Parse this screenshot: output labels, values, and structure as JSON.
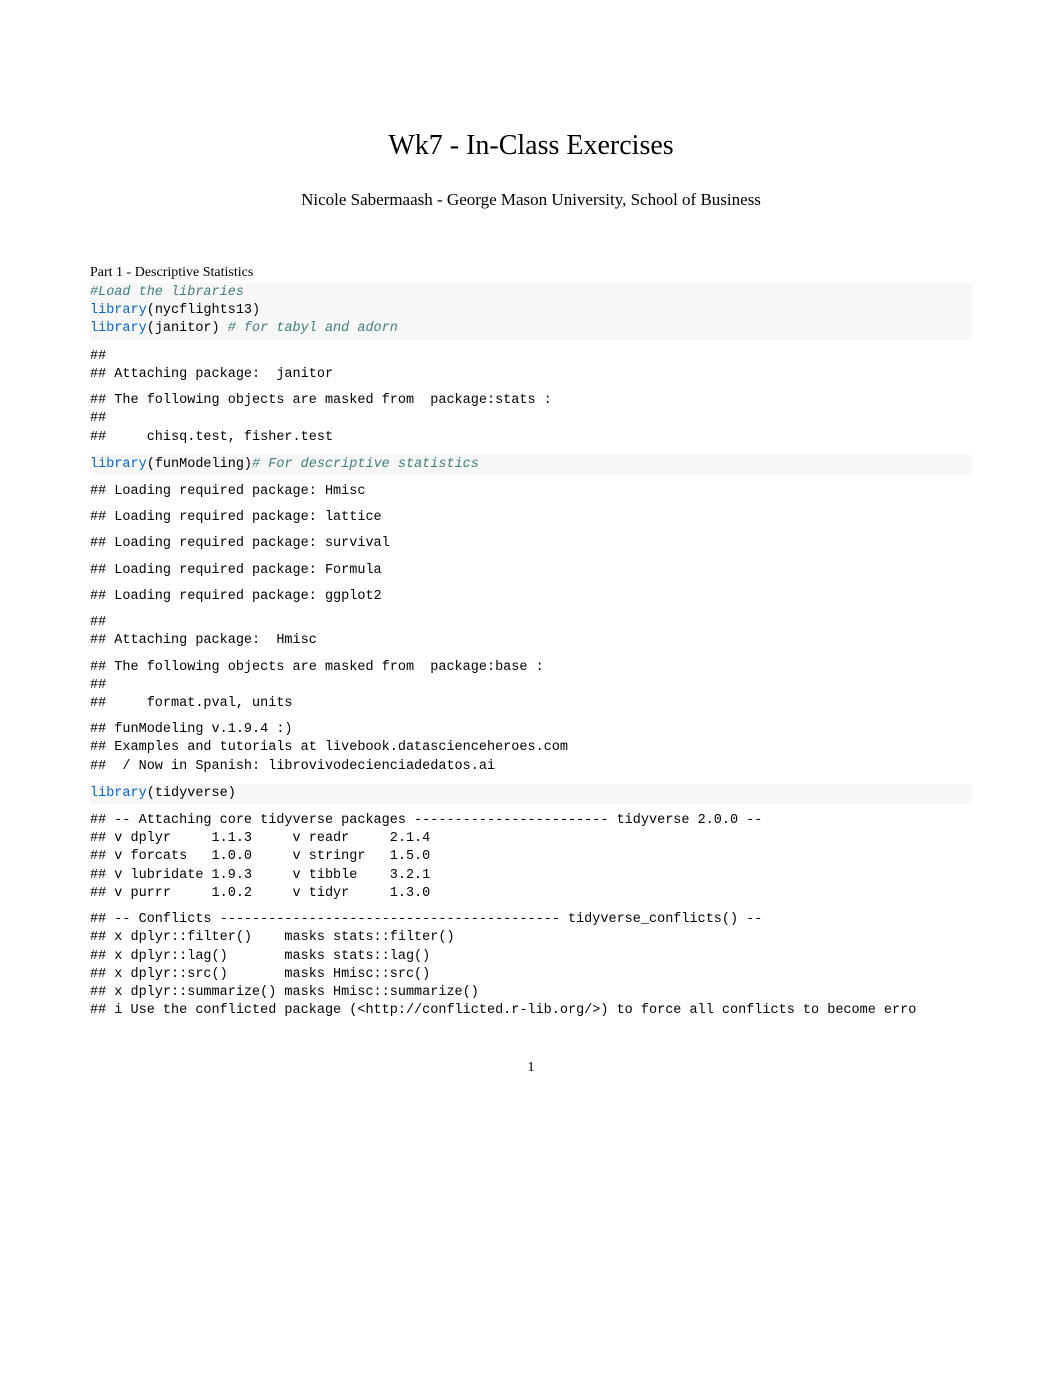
{
  "title": "Wk7 - In-Class Exercises",
  "subtitle": "Nicole Sabermaash - George Mason University, School of Business",
  "section1": "Part 1 - Descriptive Statistics",
  "code": {
    "c1": "#Load the libraries",
    "c2a": "library",
    "c2b": "(nycflights13)",
    "c3a": "library",
    "c3b": "(janitor) ",
    "c3c": "# for tabyl and adorn",
    "c4a": "library",
    "c4b": "(funModeling)",
    "c4c": "# For descriptive statistics",
    "c5a": "library",
    "c5b": "(tidyverse)"
  },
  "out": {
    "block1": "##\n## Attaching package:  janitor",
    "block2": "## The following objects are masked from  package:stats :\n##\n##     chisq.test, fisher.test",
    "block3": "## Loading required package: Hmisc",
    "block4": "## Loading required package: lattice",
    "block5": "## Loading required package: survival",
    "block6": "## Loading required package: Formula",
    "block7": "## Loading required package: ggplot2",
    "block8": "##\n## Attaching package:  Hmisc",
    "block9": "## The following objects are masked from  package:base :\n##\n##     format.pval, units",
    "block10": "## funModeling v.1.9.4 :)\n## Examples and tutorials at livebook.datascienceheroes.com\n##  / Now in Spanish: librovivodecienciadedatos.ai",
    "block11": "## -- Attaching core tidyverse packages ------------------------ tidyverse 2.0.0 --\n## v dplyr     1.1.3     v readr     2.1.4\n## v forcats   1.0.0     v stringr   1.5.0\n## v lubridate 1.9.3     v tibble    3.2.1\n## v purrr     1.0.2     v tidyr     1.3.0",
    "block12": "## -- Conflicts ------------------------------------------ tidyverse_conflicts() --\n## x dplyr::filter()    masks stats::filter()\n## x dplyr::lag()       masks stats::lag()\n## x dplyr::src()       masks Hmisc::src()\n## x dplyr::summarize() masks Hmisc::summarize()\n## i Use the conflicted package (<http://conflicted.r-lib.org/>) to force all conflicts to become erro"
  },
  "pageNumber": "1"
}
